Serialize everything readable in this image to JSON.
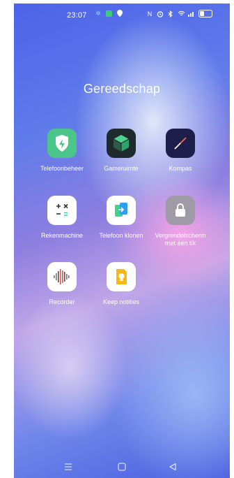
{
  "status_bar": {
    "time": "23:07",
    "left_icons": [
      "gear-icon",
      "app-notification-icon",
      "location-icon"
    ],
    "right_icons": [
      "nfc-icon",
      "alarm-icon",
      "bluetooth-icon",
      "wifi-icon",
      "signal-icon",
      "battery-icon"
    ]
  },
  "folder": {
    "title": "Gereedschap",
    "apps": [
      {
        "label": "Telefoonbeheer",
        "icon": "shield-bolt-icon",
        "color": "#4cc58a"
      },
      {
        "label": "Gameruimte",
        "icon": "gamespace-icon",
        "color": "#1f2a2e"
      },
      {
        "label": "Kompas",
        "icon": "compass-icon",
        "color": "#1d1f4a"
      },
      {
        "label": "Rekenmachine",
        "icon": "calculator-icon",
        "color": "#ffffff"
      },
      {
        "label": "Telefoon klonen",
        "icon": "clone-phone-icon",
        "color": "#ffffff"
      },
      {
        "label": "Vergrendelscherm met één tik",
        "icon": "lock-icon",
        "color": "#9e9ba7"
      },
      {
        "label": "Recorder",
        "icon": "waveform-icon",
        "color": "#ffffff"
      },
      {
        "label": "Keep notities",
        "icon": "keep-bulb-icon",
        "color": "#ffffff"
      }
    ]
  },
  "nav": {
    "items": [
      "menu-icon",
      "home-icon",
      "back-icon"
    ]
  }
}
